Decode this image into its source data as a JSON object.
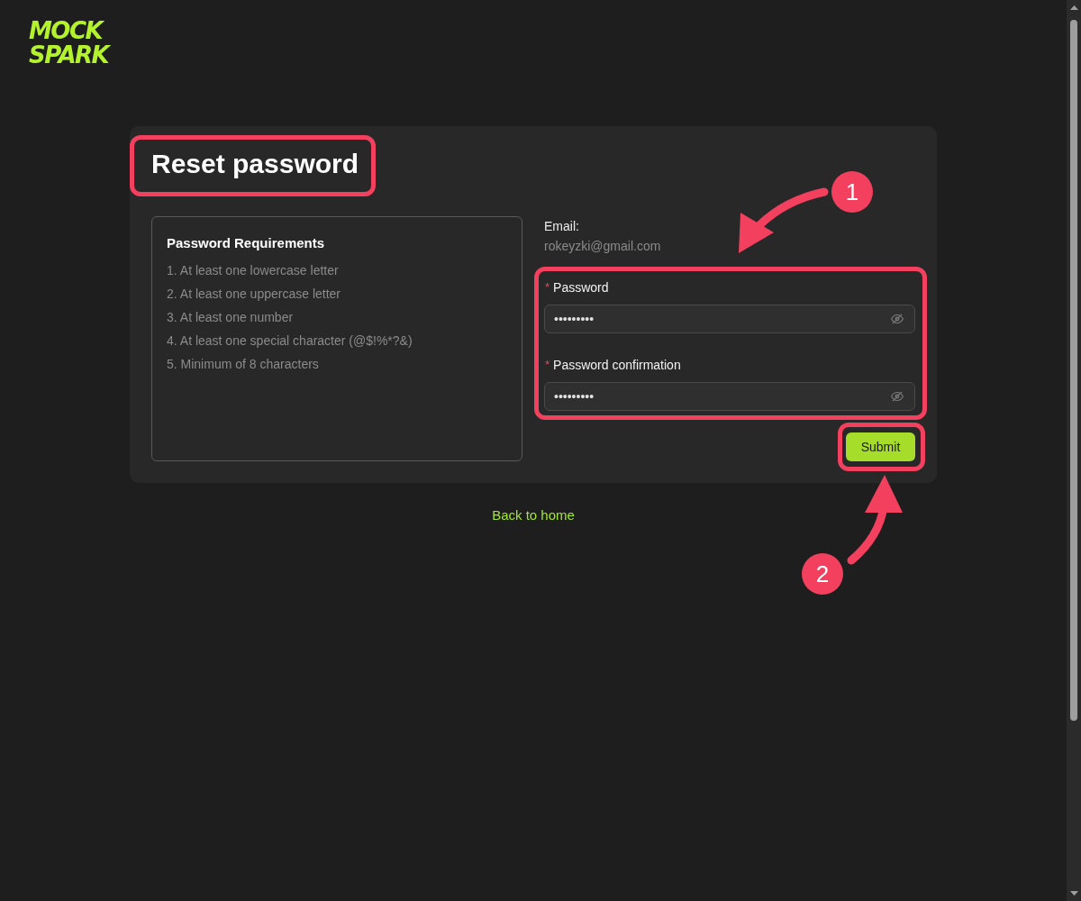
{
  "logo": {
    "lines": [
      "MOCK",
      "SPARK"
    ]
  },
  "card": {
    "title": {
      "text": "Reset password",
      "highlighted": true
    },
    "requirements": {
      "heading": "Password Requirements",
      "items": [
        "1. At least one lowercase letter",
        "2. At least one uppercase letter",
        "3. At least one number",
        "4. At least one special character (@$!%*?&)",
        "5. Minimum of 8 characters"
      ]
    },
    "email": {
      "label": "Email:",
      "value": "rokeyzki@gmail.com"
    },
    "password_group": {
      "highlighted": true,
      "fields": [
        {
          "required_mark": "*",
          "label": "Password",
          "value": "•••••••••"
        },
        {
          "required_mark": "*",
          "label": "Password confirmation",
          "value": "•••••••••"
        }
      ]
    },
    "submit": {
      "label": "Submit",
      "highlighted": true
    }
  },
  "back_link": {
    "label": "Back to home"
  },
  "callouts": [
    {
      "label": "1"
    },
    {
      "label": "2"
    }
  ]
}
